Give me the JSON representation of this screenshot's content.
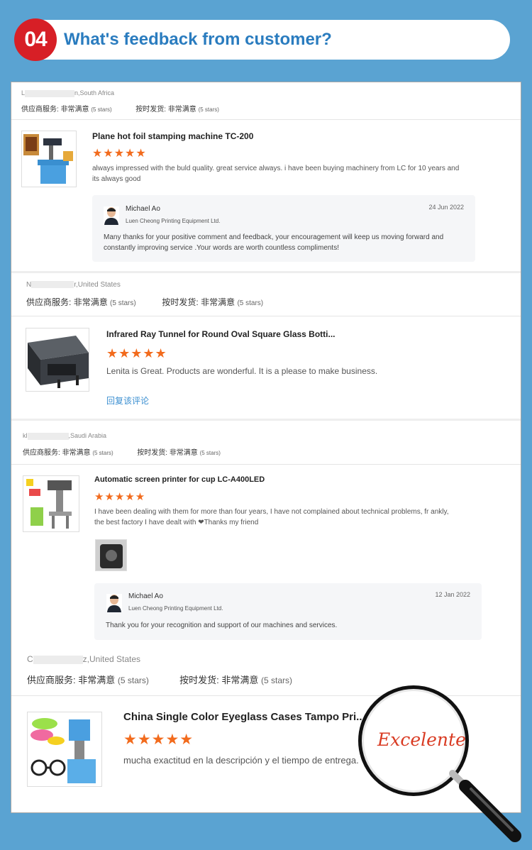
{
  "header": {
    "badge": "04",
    "title": "What's feedback from customer?"
  },
  "labels": {
    "supplier_service": "供应商服务:",
    "on_time": "按时发货:",
    "very_satisfied": "非常满意",
    "five_stars": "(5 stars)"
  },
  "reviews": [
    {
      "customer_suffix": "n,South Africa",
      "product": "Plane hot foil stamping machine TC-200",
      "stars": "★★★★★",
      "text": "always impressed with the buld quality. great service always. i have been buying machinery from LC for 10 years and its always good",
      "reply": {
        "name": "Michael Ao",
        "company": "Luen Cheong Printing Equipment Ltd.",
        "date": "24 Jun 2022",
        "text": "Many thanks for your positive comment and feedback, your encouragement will keep us moving forward and constantly improving service .Your words are worth countless compliments!"
      }
    },
    {
      "customer_suffix": "r,United States",
      "product": "Infrared Ray Tunnel for Round Oval Square Glass Botti...",
      "stars": "★★★★★",
      "text": "Lenita is Great. Products are wonderful. It is a please to make business.",
      "reply_link": "回复该评论"
    },
    {
      "customer_suffix": ",Saudi Arabia",
      "customer_prefix": "kl",
      "product": "Automatic screen printer for cup LC-A400LED",
      "stars": "★★★★★",
      "text": "I have been dealing with them for more than four years, I have not complained about technical problems, fr ankly, the best factory I have dealt with ❤Thanks my friend",
      "reply": {
        "name": "Michael Ao",
        "company": "Luen Cheong Printing Equipment Ltd.",
        "date": "12 Jan 2022",
        "text": "Thank you for your recognition and support of our machines and services."
      }
    },
    {
      "customer_suffix": "z,United States",
      "customer_prefix": "C",
      "product": "China Single Color Eyeglass Cases Tampo Pri...",
      "stars": "★★★★★",
      "text": "mucha exactitud en la descripción y el tiempo de entrega."
    }
  ],
  "magnifier": {
    "text": "Excelente"
  }
}
